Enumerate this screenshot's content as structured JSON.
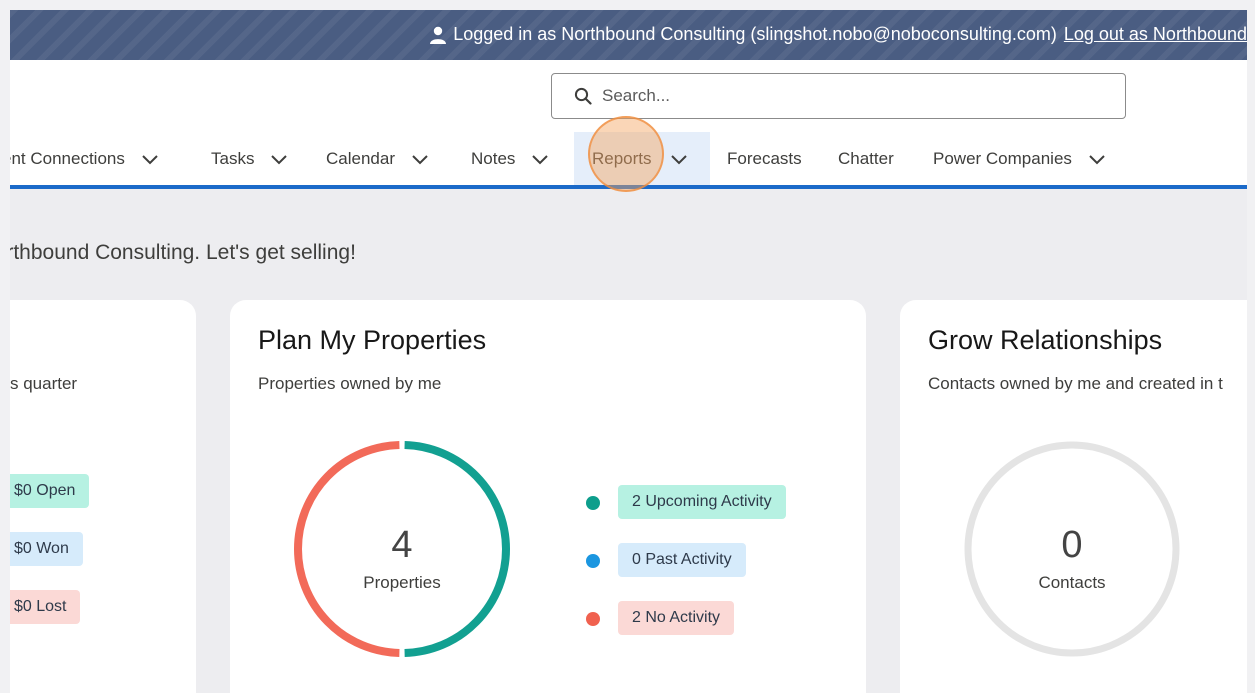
{
  "banner": {
    "logged_in_text": "Logged in as Northbound Consulting (slingshot.nobo@noboconsulting.com)",
    "logout_text": "Log out as Northbound"
  },
  "search": {
    "placeholder": "Search..."
  },
  "nav": {
    "items": [
      {
        "label": "ent Connections",
        "has_menu": true
      },
      {
        "label": "Tasks",
        "has_menu": true
      },
      {
        "label": "Calendar",
        "has_menu": true
      },
      {
        "label": "Notes",
        "has_menu": true
      },
      {
        "label": "Reports",
        "has_menu": true,
        "active": true
      },
      {
        "label": "Forecasts",
        "has_menu": false
      },
      {
        "label": "Chatter",
        "has_menu": false
      },
      {
        "label": "Power Companies",
        "has_menu": true
      }
    ]
  },
  "greeting": "lorthbound Consulting. Let's get selling!",
  "cards": {
    "left": {
      "subtitle": "s quarter",
      "pills": [
        "$0 Open",
        "$0 Won",
        "$0 Lost"
      ]
    },
    "properties": {
      "title": "Plan My Properties",
      "subtitle": "Properties owned by me",
      "count": "4",
      "count_label": "Properties",
      "legend": [
        {
          "label": "2 Upcoming Activity",
          "color": "#0d9e8c",
          "bg": "#b6f1e2"
        },
        {
          "label": "0 Past Activity",
          "color": "#1b96e0",
          "bg": "#d6ebfb"
        },
        {
          "label": "2 No Activity",
          "color": "#f0614f",
          "bg": "#fbd9d6"
        }
      ],
      "segments": [
        {
          "value": 2,
          "color": "#12a091"
        },
        {
          "value": 2,
          "color": "#f26a59"
        }
      ]
    },
    "relationships": {
      "title": "Grow Relationships",
      "subtitle": "Contacts owned by me and created in t",
      "count": "0",
      "count_label": "Contacts"
    }
  },
  "colors": {
    "banner": "#4a5d82",
    "nav_underline": "#1b6ac9",
    "active_tab_bg": "#e5eefa",
    "highlight": "#f4a460"
  }
}
